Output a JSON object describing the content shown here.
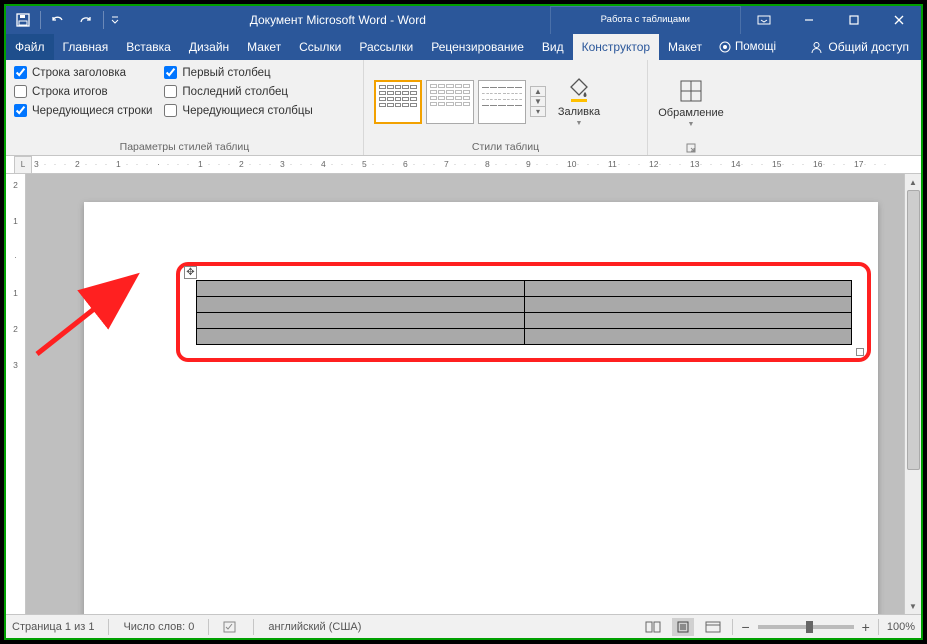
{
  "title": "Документ Microsoft Word - Word",
  "table_tools": "Работа с таблицами",
  "tabs": {
    "file": "Файл",
    "home": "Главная",
    "insert": "Вставка",
    "design": "Дизайн",
    "layout": "Макет",
    "references": "Ссылки",
    "mailings": "Рассылки",
    "review": "Рецензирование",
    "view": "Вид",
    "tdesign": "Конструктор",
    "tlayout": "Макет"
  },
  "tellme": "Помощі",
  "share": "Общий доступ",
  "style_opts": {
    "header_row": "Строка заголовка",
    "total_row": "Строка итогов",
    "banded_rows": "Чередующиеся строки",
    "first_col": "Первый столбец",
    "last_col": "Последний столбец",
    "banded_cols": "Чередующиеся столбцы",
    "group_label": "Параметры стилей таблиц"
  },
  "styles_group": "Стили таблиц",
  "shading": "Заливка",
  "borders": "Обрамление",
  "ruler_h": [
    "3",
    "2",
    "1",
    "",
    "1",
    "2",
    "3",
    "4",
    "5",
    "6",
    "7",
    "8",
    "9",
    "10",
    "11",
    "12",
    "13",
    "14",
    "15",
    "16",
    "17"
  ],
  "ruler_v": [
    "2",
    "1",
    "",
    "1",
    "2",
    "3"
  ],
  "status": {
    "page": "Страница 1 из 1",
    "words": "Число слов: 0",
    "lang": "английский (США)",
    "zoom": "100%"
  }
}
